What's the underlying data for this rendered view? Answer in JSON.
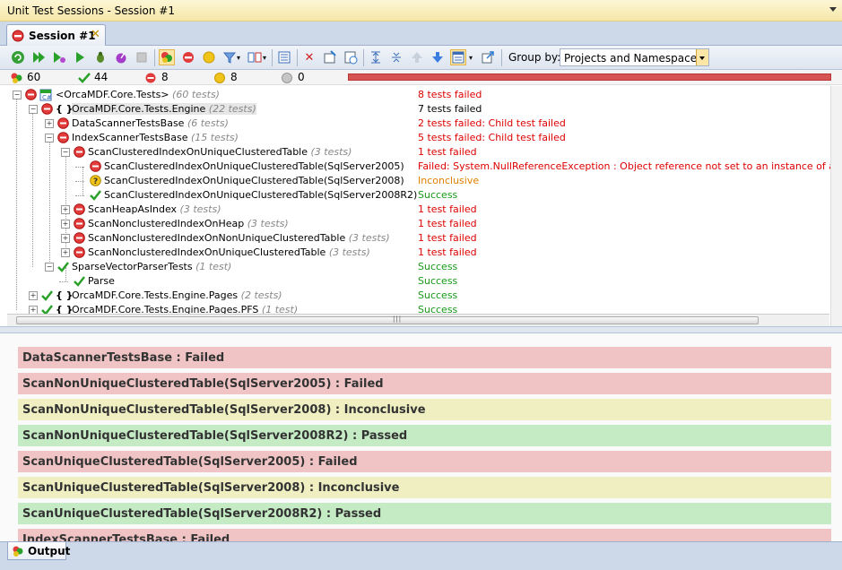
{
  "window": {
    "title": "Unit Test Sessions - Session #1"
  },
  "tab": {
    "label": "Session #1"
  },
  "toolbar": {
    "group_by_label": "Group by:",
    "group_by_value": "Projects and Namespaces"
  },
  "stats": {
    "total": "60",
    "passed": "44",
    "failed": "8",
    "inconclusive": "8",
    "ignored": "0"
  },
  "tree": [
    {
      "name": "<OrcaMDF.Core.Tests>",
      "count": "(60 tests)",
      "result": "8 tests failed",
      "status": "failed"
    },
    {
      "name": "OrcaMDF.Core.Tests.Engine",
      "count": "(22 tests)",
      "result": "7 tests failed",
      "status": "failed"
    },
    {
      "name": "DataScannerTestsBase",
      "count": "(6 tests)",
      "result": "2 tests failed: Child test failed",
      "status": "failed"
    },
    {
      "name": "IndexScannerTestsBase",
      "count": "(15 tests)",
      "result": "5 tests failed: Child test failed",
      "status": "failed"
    },
    {
      "name": "ScanClusteredIndexOnUniqueClusteredTable",
      "count": "(3 tests)",
      "result": "1 test failed",
      "status": "failed"
    },
    {
      "name": "ScanClusteredIndexOnUniqueClusteredTable(SqlServer2005)",
      "count": "",
      "result": "Failed: System.NullReferenceException : Object reference not set to an instance of an object.",
      "status": "failed"
    },
    {
      "name": "ScanClusteredIndexOnUniqueClusteredTable(SqlServer2008)",
      "count": "",
      "result": "Inconclusive",
      "status": "inconclusive"
    },
    {
      "name": "ScanClusteredIndexOnUniqueClusteredTable(SqlServer2008R2)",
      "count": "",
      "result": "Success",
      "status": "passed"
    },
    {
      "name": "ScanHeapAsIndex",
      "count": "(3 tests)",
      "result": "1 test failed",
      "status": "failed"
    },
    {
      "name": "ScanNonclusteredIndexOnHeap",
      "count": "(3 tests)",
      "result": "1 test failed",
      "status": "failed"
    },
    {
      "name": "ScanNonclusteredIndexOnNonUniqueClusteredTable",
      "count": "(3 tests)",
      "result": "1 test failed",
      "status": "failed"
    },
    {
      "name": "ScanNonclusteredIndexOnUniqueClusteredTable",
      "count": "(3 tests)",
      "result": "1 test failed",
      "status": "failed"
    },
    {
      "name": "SparseVectorParserTests",
      "count": "(1 test)",
      "result": "Success",
      "status": "passed"
    },
    {
      "name": "Parse",
      "count": "",
      "result": "Success",
      "status": "passed"
    },
    {
      "name": "OrcaMDF.Core.Tests.Engine.Pages",
      "count": "(2 tests)",
      "result": "Success",
      "status": "passed"
    },
    {
      "name": "OrcaMDF.Core.Tests.Engine.Pages.PFS",
      "count": "(1 test)",
      "result": "Success",
      "status": "passed"
    }
  ],
  "output": [
    {
      "text": "DataScannerTestsBase : Failed",
      "status": "failed"
    },
    {
      "text": "ScanNonUniqueClusteredTable(SqlServer2005) : Failed",
      "status": "failed"
    },
    {
      "text": "ScanNonUniqueClusteredTable(SqlServer2008) : Inconclusive",
      "status": "inconclusive"
    },
    {
      "text": "ScanNonUniqueClusteredTable(SqlServer2008R2) : Passed",
      "status": "passed"
    },
    {
      "text": "ScanUniqueClusteredTable(SqlServer2005) : Failed",
      "status": "failed"
    },
    {
      "text": "ScanUniqueClusteredTable(SqlServer2008) : Inconclusive",
      "status": "inconclusive"
    },
    {
      "text": "ScanUniqueClusteredTable(SqlServer2008R2) : Passed",
      "status": "passed"
    },
    {
      "text": "IndexScannerTestsBase : Failed",
      "status": "failed"
    }
  ],
  "bottom": {
    "output_tab": "Output"
  },
  "colors": {
    "failed": "#dd0000",
    "passed": "#169a16",
    "inconclusive": "#e08000"
  }
}
